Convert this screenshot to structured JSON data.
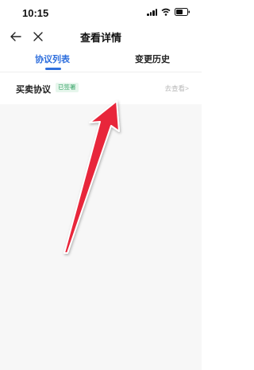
{
  "status_bar": {
    "time": "10:15"
  },
  "nav": {
    "title": "查看详情"
  },
  "tabs": [
    {
      "label": "协议列表",
      "active": true
    },
    {
      "label": "变更历史",
      "active": false
    }
  ],
  "agreement": {
    "name": "买卖协议",
    "status": "已签署",
    "action": "去查看>"
  },
  "colors": {
    "accent": "#2f6fdd",
    "badge_text": "#3aa56a",
    "badge_bg": "#e6f6ec",
    "arrow": "#e8273a"
  },
  "icons": [
    "back-arrow-icon",
    "close-icon",
    "signal-icon",
    "wifi-icon",
    "battery-icon"
  ]
}
